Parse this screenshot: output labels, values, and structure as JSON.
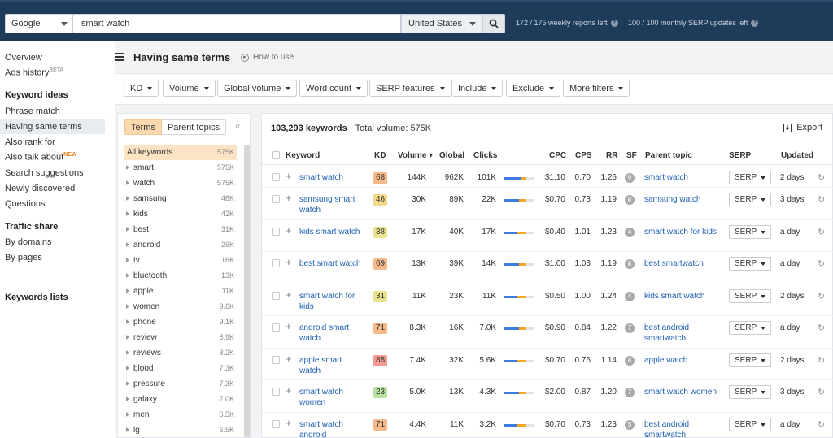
{
  "top": {
    "engine": "Google",
    "query": "smart watch",
    "country": "United States",
    "weekly": "172 / 175 weekly reports left",
    "monthly": "100 / 100 monthly SERP updates left"
  },
  "nav": {
    "overview": "Overview",
    "ads_history": "Ads history",
    "beta": "BETA",
    "keyword_ideas": "Keyword ideas",
    "phrase_match": "Phrase match",
    "having_same_terms": "Having same terms",
    "also_rank_for": "Also rank for",
    "also_talk_about": "Also talk about",
    "new": "NEW",
    "search_suggestions": "Search suggestions",
    "newly_discovered": "Newly discovered",
    "questions": "Questions",
    "traffic_share": "Traffic share",
    "by_domains": "By domains",
    "by_pages": "By pages",
    "keywords_lists": "Keywords lists"
  },
  "page": {
    "title": "Having same terms",
    "how_to": "How to use"
  },
  "filters": [
    "KD",
    "Volume",
    "Global volume",
    "Word count",
    "SERP features",
    "Include",
    "Exclude",
    "More filters"
  ],
  "terms": {
    "tab_terms": "Terms",
    "tab_parent": "Parent topics",
    "collapse": "«",
    "items": [
      {
        "label": "All keywords",
        "count": "575K"
      },
      {
        "label": "smart",
        "count": "575K"
      },
      {
        "label": "watch",
        "count": "575K"
      },
      {
        "label": "samsung",
        "count": "46K"
      },
      {
        "label": "kids",
        "count": "42K"
      },
      {
        "label": "best",
        "count": "31K"
      },
      {
        "label": "android",
        "count": "26K"
      },
      {
        "label": "tv",
        "count": "16K"
      },
      {
        "label": "bluetooth",
        "count": "13K"
      },
      {
        "label": "apple",
        "count": "11K"
      },
      {
        "label": "women",
        "count": "9.6K"
      },
      {
        "label": "phone",
        "count": "9.1K"
      },
      {
        "label": "review",
        "count": "8.9K"
      },
      {
        "label": "reviews",
        "count": "8.2K"
      },
      {
        "label": "blood",
        "count": "7.3K"
      },
      {
        "label": "pressure",
        "count": "7.3K"
      },
      {
        "label": "galaxy",
        "count": "7.0K"
      },
      {
        "label": "men",
        "count": "6.5K"
      },
      {
        "label": "lg",
        "count": "6.5K"
      }
    ]
  },
  "table": {
    "count": "103,293 keywords",
    "total_volume": "Total volume: 575K",
    "export": "Export",
    "headers": {
      "keyword": "Keyword",
      "kd": "KD",
      "volume": "Volume ▾",
      "global": "Global",
      "clicks": "Clicks",
      "cpc": "CPC",
      "cps": "CPS",
      "rr": "RR",
      "sf": "SF",
      "parent": "Parent topic",
      "serp": "SERP",
      "updated": "Updated"
    },
    "serp_label": "SERP",
    "rows": [
      {
        "kw": "smart watch",
        "kd": "68",
        "kd_color": "#f7b98a",
        "vol": "144K",
        "global": "962K",
        "clicks": "101K",
        "bar_blue": 0.55,
        "bar_orange": 0.15,
        "cpc": "$1.10",
        "cps": "0.70",
        "rr": "1.26",
        "sf": "9",
        "parent": "smart watch",
        "updated": "2 days"
      },
      {
        "kw": "samsung smart watch",
        "kd": "46",
        "kd_color": "#f5d98a",
        "vol": "30K",
        "global": "89K",
        "clicks": "22K",
        "bar_blue": 0.5,
        "bar_orange": 0.2,
        "cpc": "$0.70",
        "cps": "0.73",
        "rr": "1.19",
        "sf": "8",
        "parent": "samsung watch",
        "updated": "3 days"
      },
      {
        "kw": "kids smart watch",
        "kd": "38",
        "kd_color": "#e9e48d",
        "vol": "17K",
        "global": "40K",
        "clicks": "17K",
        "bar_blue": 0.45,
        "bar_orange": 0.25,
        "cpc": "$0.40",
        "cps": "1.01",
        "rr": "1.23",
        "sf": "4",
        "parent": "smart watch for kids",
        "updated": "a day"
      },
      {
        "kw": "best smart watch",
        "kd": "69",
        "kd_color": "#f7b98a",
        "vol": "13K",
        "global": "39K",
        "clicks": "14K",
        "bar_blue": 0.5,
        "bar_orange": 0.2,
        "cpc": "$1.00",
        "cps": "1.03",
        "rr": "1.19",
        "sf": "8",
        "parent": "best smartwatch",
        "updated": "a day"
      },
      {
        "kw": "smart watch for kids",
        "kd": "31",
        "kd_color": "#e9e48d",
        "vol": "11K",
        "global": "23K",
        "clicks": "11K",
        "bar_blue": 0.45,
        "bar_orange": 0.25,
        "cpc": "$0.50",
        "cps": "1.00",
        "rr": "1.24",
        "sf": "4",
        "parent": "kids smart watch",
        "updated": "2 days"
      },
      {
        "kw": "android smart watch",
        "kd": "71",
        "kd_color": "#f7b98a",
        "vol": "8.3K",
        "global": "16K",
        "clicks": "7.0K",
        "bar_blue": 0.5,
        "bar_orange": 0.2,
        "cpc": "$0.90",
        "cps": "0.84",
        "rr": "1.22",
        "sf": "7",
        "parent": "best android smartwatch",
        "updated": "a day"
      },
      {
        "kw": "apple smart watch",
        "kd": "85",
        "kd_color": "#f39a93",
        "vol": "7.4K",
        "global": "32K",
        "clicks": "5.6K",
        "bar_blue": 0.45,
        "bar_orange": 0.25,
        "cpc": "$0.70",
        "cps": "0.76",
        "rr": "1.14",
        "sf": "8",
        "parent": "apple watch",
        "updated": "2 days"
      },
      {
        "kw": "smart watch women",
        "kd": "23",
        "kd_color": "#b9e2a2",
        "vol": "5.0K",
        "global": "13K",
        "clicks": "4.3K",
        "bar_blue": 0.5,
        "bar_orange": 0.2,
        "cpc": "$2.00",
        "cps": "0.87",
        "rr": "1.20",
        "sf": "7",
        "parent": "smart watch women",
        "updated": "3 days"
      },
      {
        "kw": "smart watch android",
        "kd": "71",
        "kd_color": "#f7b98a",
        "vol": "4.4K",
        "global": "11K",
        "clicks": "3.2K",
        "bar_blue": 0.45,
        "bar_orange": 0.25,
        "cpc": "$0.70",
        "cps": "0.73",
        "rr": "1.23",
        "sf": "5",
        "parent": "best android smartwatch",
        "updated": "a day"
      }
    ]
  },
  "colors": {
    "topbar": "#1f3b5a",
    "link": "#1d5fb4",
    "bar_blue": "#3d7be0",
    "bar_orange": "#f5a623",
    "selected_term": "#fce3c3"
  },
  "icons": {
    "search": "search-icon",
    "hamburger": "hamburger-icon",
    "export": "download-icon",
    "refresh": "refresh-icon"
  }
}
